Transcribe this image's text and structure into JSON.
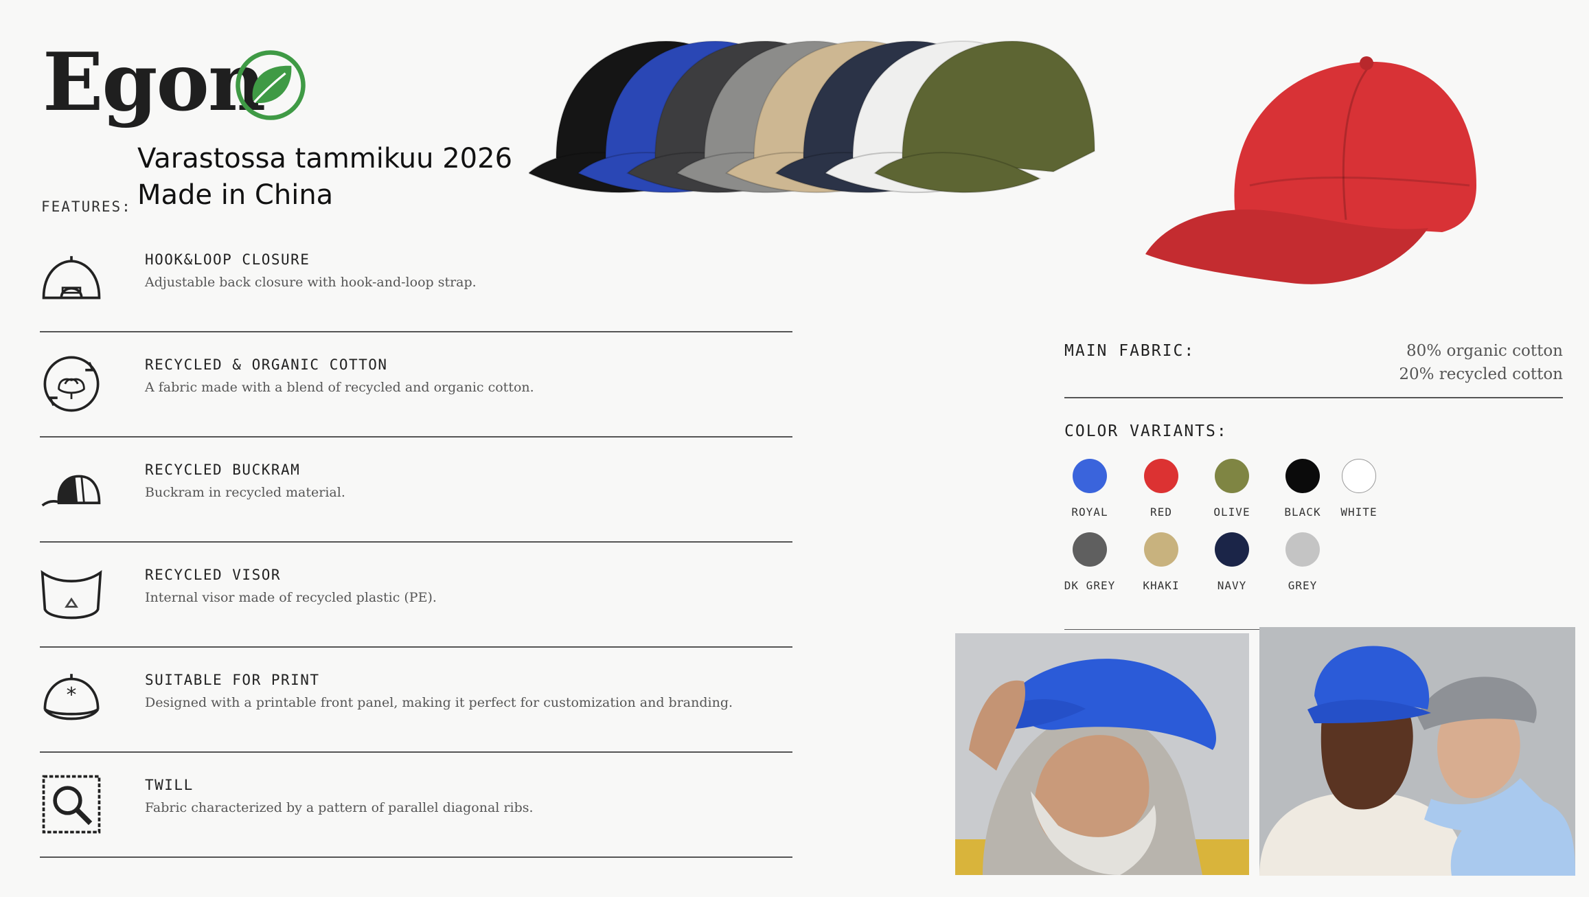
{
  "brand": {
    "name": "Egon"
  },
  "promo": {
    "line1": "Varastossa tammikuu 2026",
    "line2": "Made in China"
  },
  "features_label": "FEATURES:",
  "features": [
    {
      "icon": "cap-back-closure-icon",
      "title": "HOOK&LOOP CLOSURE",
      "desc": "Adjustable back closure with hook-and-loop strap."
    },
    {
      "icon": "recycled-cotton-icon",
      "title": "RECYCLED & ORGANIC COTTON",
      "desc": "A fabric made with a blend of recycled and organic cotton."
    },
    {
      "icon": "cap-side-buckram-icon",
      "title": "RECYCLED BUCKRAM",
      "desc": "Buckram in recycled material."
    },
    {
      "icon": "visor-recycle-icon",
      "title": "RECYCLED VISOR",
      "desc": "Internal visor made of recycled plastic (PE)."
    },
    {
      "icon": "cap-print-star-icon",
      "title": "SUITABLE FOR PRINT",
      "desc": "Designed with a printable front panel, making it perfect for customization and branding."
    },
    {
      "icon": "magnifier-stamp-icon",
      "title": "TWILL",
      "desc": "Fabric characterized by a pattern of parallel diagonal ribs."
    }
  ],
  "fabric": {
    "label": "MAIN FABRIC:",
    "line1": "80% organic cotton",
    "line2": "20% recycled cotton"
  },
  "colors": {
    "label": "COLOR VARIANTS:",
    "items": [
      {
        "name": "ROYAL",
        "hex": "#3a64dc"
      },
      {
        "name": "RED",
        "hex": "#dc3232"
      },
      {
        "name": "OLIVE",
        "hex": "#7f8543"
      },
      {
        "name": "BLACK",
        "hex": "#0b0b0b"
      },
      {
        "name": "WHITE",
        "hex": "#ffffff"
      },
      {
        "name": "DK GREY",
        "hex": "#5f5f5f"
      },
      {
        "name": "KHAKI",
        "hex": "#c8b27e"
      },
      {
        "name": "NAVY",
        "hex": "#1b2548"
      },
      {
        "name": "GREY",
        "hex": "#c4c4c4"
      }
    ]
  },
  "caps_row_colors": [
    "#151515",
    "#2a47b5",
    "#3d3d3f",
    "#8c8c8a",
    "#cdb792",
    "#2b3347",
    "#efefee",
    "#5d6533"
  ],
  "hero_cap_color": "#d83236"
}
